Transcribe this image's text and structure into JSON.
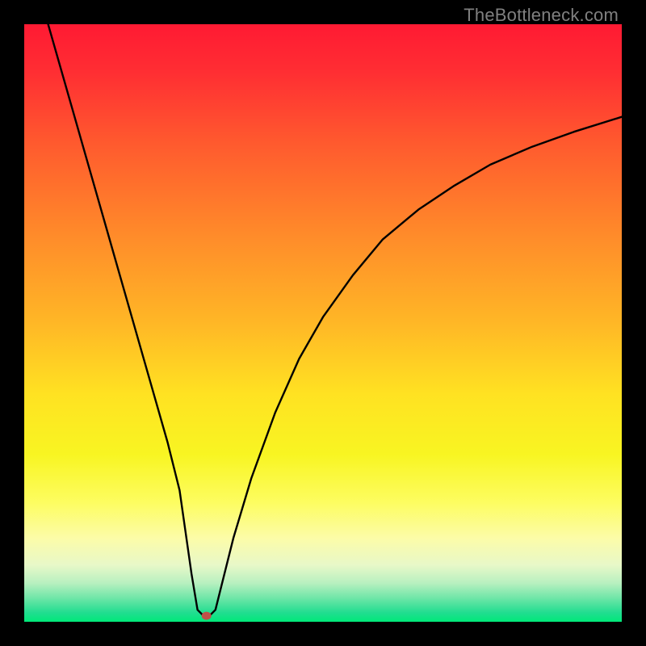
{
  "watermark": "TheBottleneck.com",
  "chart_data": {
    "type": "line",
    "title": "",
    "xlabel": "",
    "ylabel": "",
    "xlim": [
      0,
      100
    ],
    "ylim": [
      0,
      100
    ],
    "grid": false,
    "legend": false,
    "series": [
      {
        "name": "bottleneck-curve",
        "x": [
          4,
          6,
          8,
          10,
          12,
          14,
          16,
          18,
          20,
          22,
          24,
          26,
          27,
          28,
          29,
          30,
          31,
          32,
          33,
          35,
          38,
          42,
          46,
          50,
          55,
          60,
          66,
          72,
          78,
          85,
          92,
          100
        ],
        "y": [
          100,
          93,
          86,
          79,
          72,
          65,
          58,
          51,
          44,
          37,
          30,
          22,
          15,
          8,
          2,
          1,
          1,
          2,
          6,
          14,
          24,
          35,
          44,
          51,
          58,
          64,
          69,
          73,
          76.5,
          79.5,
          82,
          84.5
        ]
      }
    ],
    "marker": {
      "x": 30.5,
      "y": 1,
      "color": "#c05048",
      "rx": 6,
      "ry": 5
    },
    "gradient_stops": [
      {
        "offset": 0.0,
        "color": "#ff1a33"
      },
      {
        "offset": 0.08,
        "color": "#ff2e33"
      },
      {
        "offset": 0.2,
        "color": "#ff5a2e"
      },
      {
        "offset": 0.35,
        "color": "#ff8a2a"
      },
      {
        "offset": 0.5,
        "color": "#ffb726"
      },
      {
        "offset": 0.62,
        "color": "#ffe222"
      },
      {
        "offset": 0.72,
        "color": "#f8f522"
      },
      {
        "offset": 0.8,
        "color": "#fdfd60"
      },
      {
        "offset": 0.86,
        "color": "#fcfca8"
      },
      {
        "offset": 0.905,
        "color": "#e8f8c8"
      },
      {
        "offset": 0.935,
        "color": "#b8f0c0"
      },
      {
        "offset": 0.96,
        "color": "#70e6a8"
      },
      {
        "offset": 0.985,
        "color": "#20dd90"
      },
      {
        "offset": 1.0,
        "color": "#00e878"
      }
    ]
  }
}
